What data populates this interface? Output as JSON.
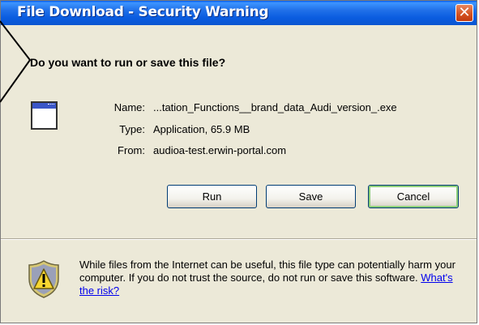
{
  "window": {
    "title": "File Download - Security Warning",
    "close_glyph": "✕"
  },
  "question": "Do you want to run or save this file?",
  "file": {
    "icon": "application-window-icon",
    "name_label": "Name:",
    "name_value": "...tation_Functions__brand_data_Audi_version_.exe",
    "type_label": "Type:",
    "type_value": "Application, 65.9 MB",
    "from_label": "From:",
    "from_value": "audioa-test.erwin-portal.com"
  },
  "buttons": {
    "run": "Run",
    "save": "Save",
    "cancel": "Cancel"
  },
  "warning": {
    "icon": "shield-warning-icon",
    "text": "While files from the Internet can be useful, this file type can potentially harm your computer. If you do not trust the source, do not run or save this software. ",
    "link": "What's the risk?"
  },
  "colors": {
    "title_bar": "#0a5ce0",
    "dialog_bg": "#ece9d8",
    "link": "#0000ee",
    "close": "#d3501e"
  }
}
